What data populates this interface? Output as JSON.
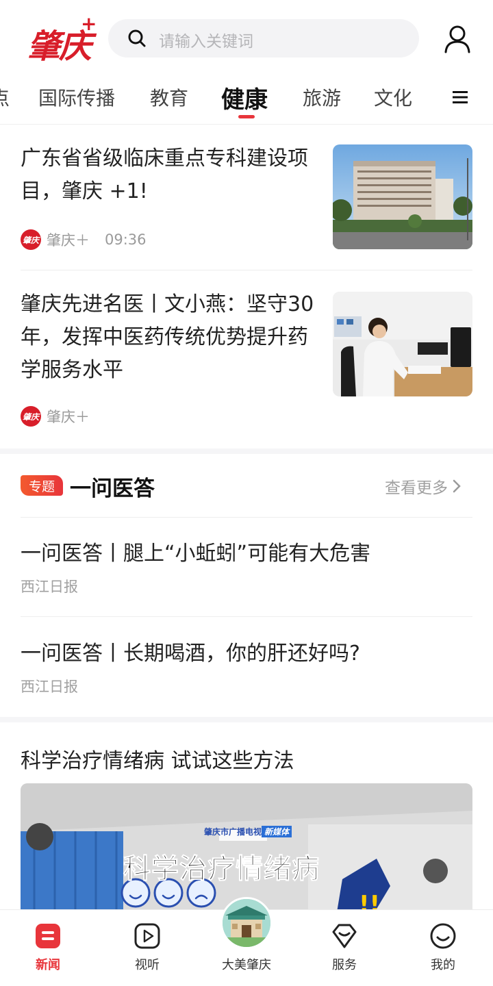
{
  "header": {
    "logo_text": "肇庆",
    "logo_plus": "+",
    "search_placeholder": "请输入关键词"
  },
  "tabs": [
    {
      "label": "点"
    },
    {
      "label": "国际传播"
    },
    {
      "label": "教育"
    },
    {
      "label": "健康",
      "active": true
    },
    {
      "label": "旅游"
    },
    {
      "label": "文化"
    }
  ],
  "news": [
    {
      "title": "广东省省级临床重点专科建设项目，肇庆 +1!",
      "source": "肇庆＋",
      "time": "09:36",
      "thumb_icon": "hospital-building-photo"
    },
    {
      "title": "肇庆先进名医丨文小燕：坚守30年，发挥中医药传统优势提升药学服务水平",
      "source": "肇庆＋",
      "thumb_icon": "doctor-at-desk-photo"
    }
  ],
  "topic": {
    "badge": "专题",
    "title": "一问医答",
    "see_more": "查看更多",
    "items": [
      {
        "title": "一问医答丨腿上“小蚯蚓”可能有大危害",
        "source": "西江日报"
      },
      {
        "title": "一问医答丨长期喝酒，你的肝还好吗?",
        "source": "西江日报"
      }
    ]
  },
  "video": {
    "title": "科学治疗情绪病 试试这些方法",
    "banner_org": "肇庆市广播电视台",
    "banner_tag": "新媒体",
    "banner_text": "科学治疗情绪病"
  },
  "bottom_nav": [
    {
      "label": "新闻",
      "icon": "news-icon",
      "active": true
    },
    {
      "label": "视听",
      "icon": "play-icon"
    },
    {
      "label": "大美肇庆",
      "icon": "landmark-icon"
    },
    {
      "label": "服务",
      "icon": "service-icon"
    },
    {
      "label": "我的",
      "icon": "profile-icon"
    }
  ],
  "colors": {
    "accent": "#e8353b",
    "brand": "#d81e2a"
  }
}
